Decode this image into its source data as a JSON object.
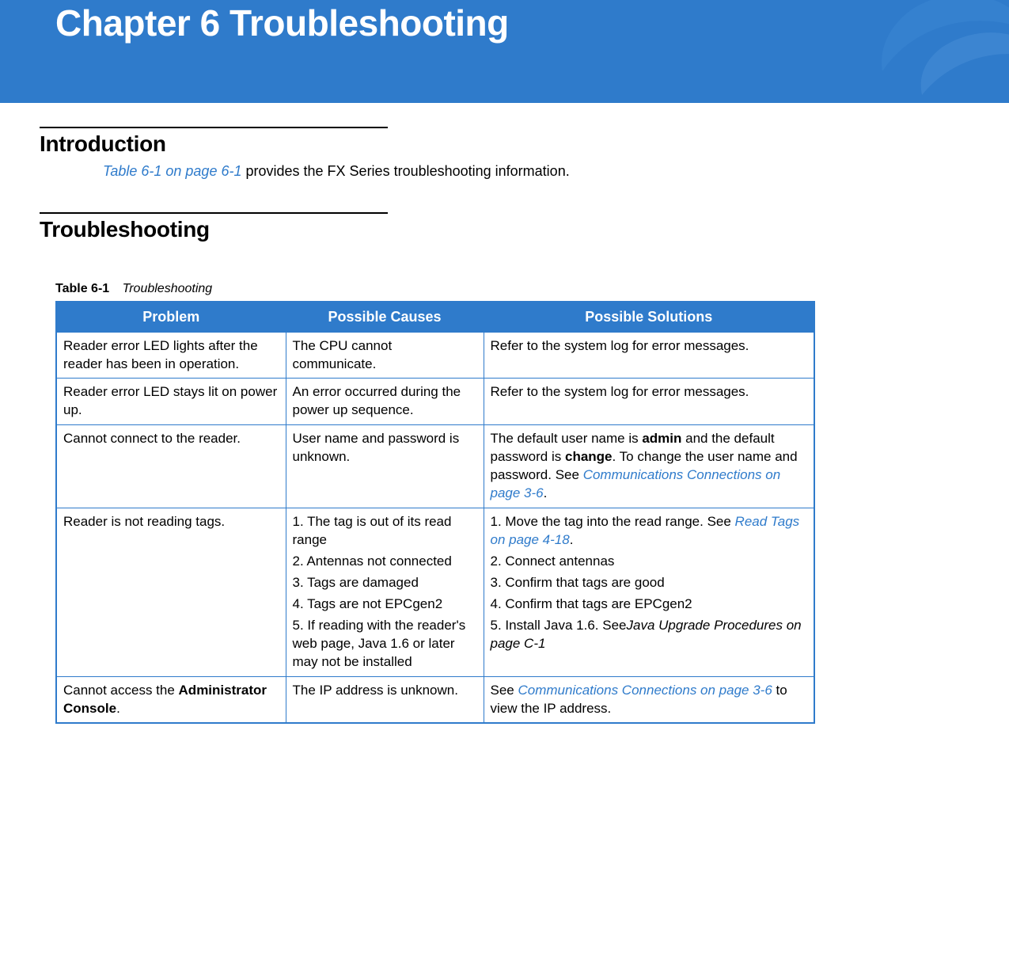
{
  "banner": {
    "title": "Chapter 6 Troubleshooting"
  },
  "sections": {
    "intro": {
      "heading": "Introduction",
      "link": "Table 6-1 on page 6-1",
      "rest": " provides the FX Series troubleshooting information."
    },
    "trouble": {
      "heading": "Troubleshooting"
    }
  },
  "table": {
    "caption_label": "Table 6-1",
    "caption_desc": "Troubleshooting",
    "headers": [
      "Problem",
      "Possible Causes",
      "Possible Solutions"
    ],
    "rows": [
      {
        "problem": [
          {
            "t": "Reader error LED lights after the reader has been in operation."
          }
        ],
        "causes": [
          {
            "t": "The CPU cannot communicate."
          }
        ],
        "solutions": [
          {
            "t": "Refer to the system log for error messages."
          }
        ]
      },
      {
        "problem": [
          {
            "t": "Reader error LED stays lit on power up."
          }
        ],
        "causes": [
          {
            "t": "An error occurred during the power up sequence."
          }
        ],
        "solutions": [
          {
            "t": "Refer to the system log for error messages."
          }
        ]
      },
      {
        "problem": [
          {
            "t": "Cannot connect to the reader."
          }
        ],
        "causes": [
          {
            "t": "User name and password is unknown."
          }
        ],
        "solutions": [
          {
            "runs": [
              {
                "t": "The default user name is "
              },
              {
                "t": "admin",
                "b": true
              },
              {
                "t": " and the default password is "
              },
              {
                "t": "change",
                "b": true
              },
              {
                "t": ". To change the user name and password. See "
              },
              {
                "t": "Communications Connections on page 3-6",
                "link": true
              },
              {
                "t": "."
              }
            ]
          }
        ]
      },
      {
        "problem": [
          {
            "t": "Reader is not reading tags."
          }
        ],
        "causes": [
          {
            "t": "1. The tag is out of its read range"
          },
          {
            "t": "2. Antennas not connected"
          },
          {
            "t": "3. Tags are damaged"
          },
          {
            "t": "4. Tags are not EPCgen2"
          },
          {
            "t": "5. If reading with the reader's web page, Java 1.6 or later may not be installed"
          }
        ],
        "solutions": [
          {
            "runs": [
              {
                "t": "1. Move the tag into the read range. See "
              },
              {
                "t": "Read Tags on page 4-18",
                "link": true
              },
              {
                "t": "."
              }
            ]
          },
          {
            "t": "2. Connect antennas"
          },
          {
            "t": "3. Confirm that tags are good"
          },
          {
            "t": "4. Confirm that tags are EPCgen2"
          },
          {
            "runs": [
              {
                "t": "5. Install Java 1.6. See"
              },
              {
                "t": "Java Upgrade Procedures on page C-1",
                "i": true
              }
            ]
          }
        ]
      },
      {
        "problem": [
          {
            "runs": [
              {
                "t": "Cannot access the "
              },
              {
                "t": "Administrator Console",
                "b": true
              },
              {
                "t": "."
              }
            ]
          }
        ],
        "causes": [
          {
            "t": "The IP address is unknown."
          }
        ],
        "solutions": [
          {
            "runs": [
              {
                "t": "See "
              },
              {
                "t": "Communications Connections on page 3-6",
                "link": true
              },
              {
                "t": " to view the IP address."
              }
            ]
          }
        ]
      }
    ]
  }
}
